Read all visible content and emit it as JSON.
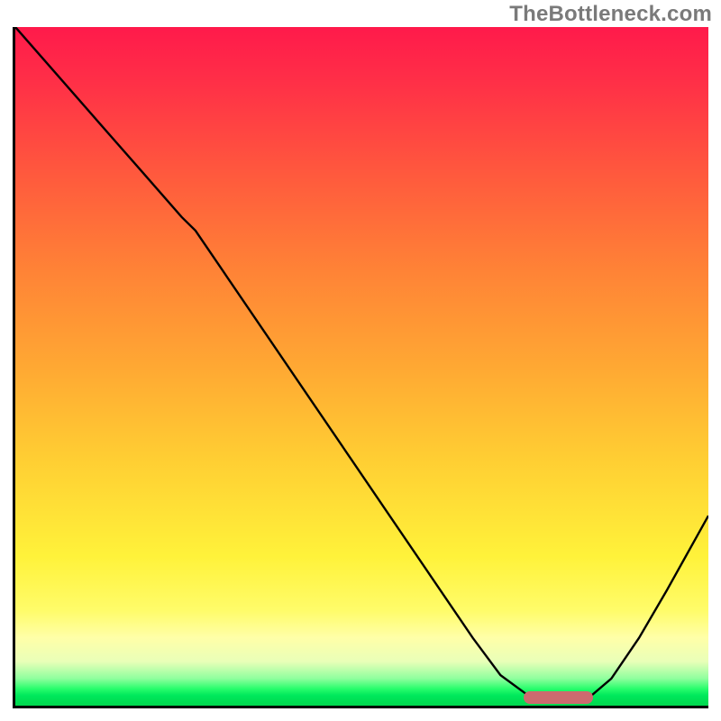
{
  "watermark": "TheBottleneck.com",
  "chart_data": {
    "type": "line",
    "title": "",
    "xlabel": "",
    "ylabel": "",
    "xlim": [
      0,
      100
    ],
    "ylim": [
      0,
      100
    ],
    "grid": false,
    "legend": false,
    "background_gradient": {
      "direction": "vertical",
      "stops": [
        {
          "pos": 0,
          "color": "#ff1a4b"
        },
        {
          "pos": 0.22,
          "color": "#ff5a3d"
        },
        {
          "pos": 0.5,
          "color": "#ffa833"
        },
        {
          "pos": 0.78,
          "color": "#fff23a"
        },
        {
          "pos": 0.9,
          "color": "#ffffa8"
        },
        {
          "pos": 0.96,
          "color": "#8fff9e"
        },
        {
          "pos": 1.0,
          "color": "#00d84e"
        }
      ]
    },
    "series": [
      {
        "name": "bottleneck-curve",
        "color": "#000000",
        "x": [
          0,
          6,
          12,
          18,
          24,
          26,
          30,
          36,
          42,
          48,
          54,
          60,
          66,
          70,
          74,
          78,
          82,
          86,
          90,
          94,
          100
        ],
        "y": [
          100,
          93,
          86,
          79,
          72,
          70,
          64,
          55,
          46,
          37,
          28,
          19,
          10,
          4.5,
          1.5,
          0.5,
          0.5,
          4,
          10,
          17,
          28
        ]
      }
    ],
    "marker": {
      "name": "optimal-range",
      "color": "#cd6a6f",
      "x_start": 73,
      "x_end": 83,
      "y": 1.2
    }
  }
}
